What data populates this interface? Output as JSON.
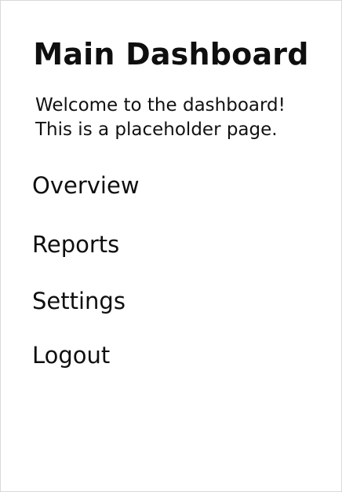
{
  "page": {
    "title": "Main Dashboard",
    "welcome_line1": "Welcome to the dashboard!",
    "welcome_line2": "This is a placeholder page."
  },
  "nav": {
    "items": [
      {
        "label": "Overview"
      },
      {
        "label": "Reports"
      },
      {
        "label": "Settings"
      },
      {
        "label": "Logout"
      }
    ]
  },
  "colors": {
    "background": "#ffffff",
    "text": "#111111",
    "border": "#d9d9d9"
  }
}
